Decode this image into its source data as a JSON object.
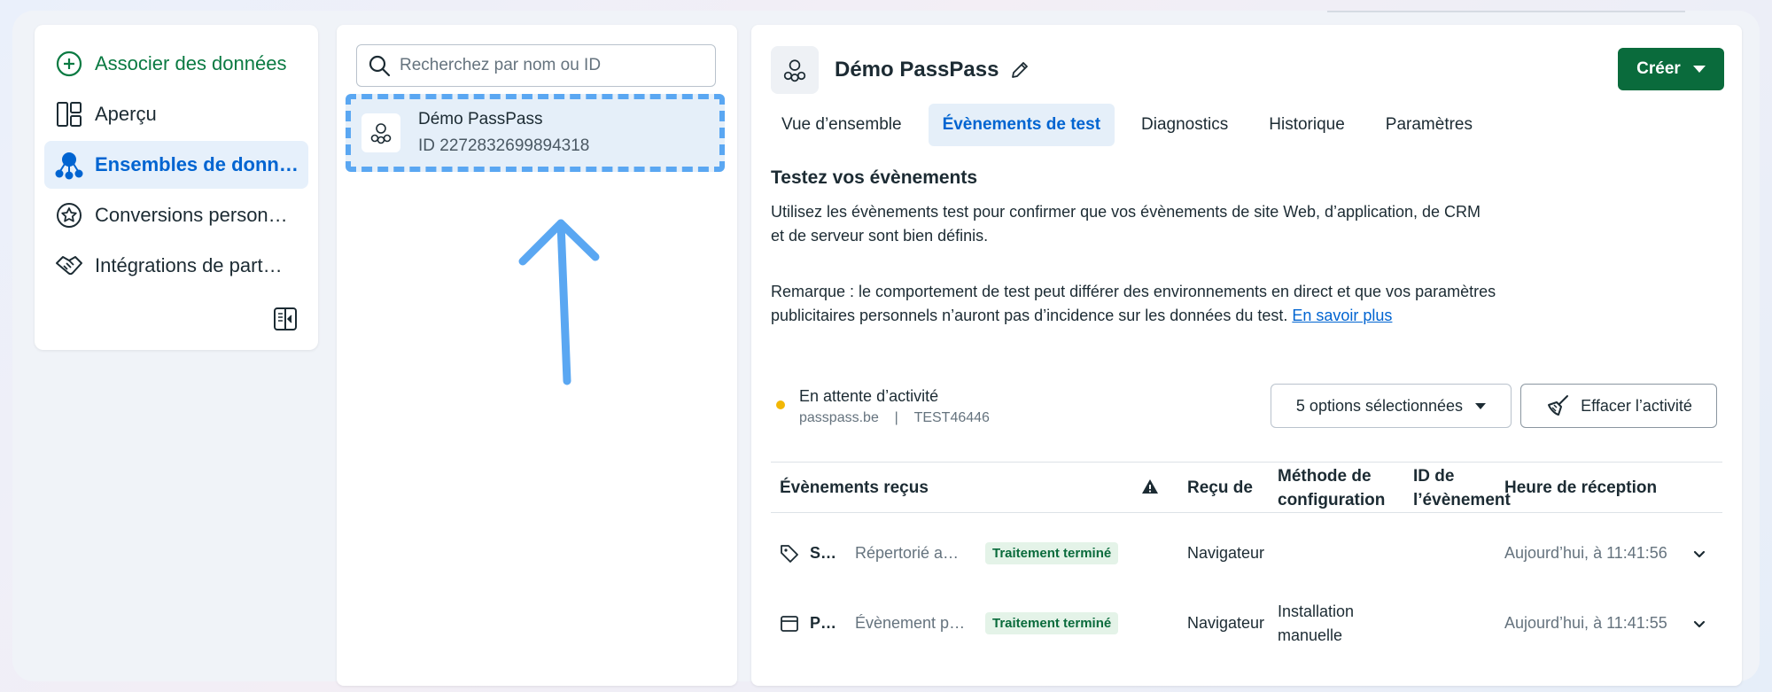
{
  "nav": {
    "items": [
      {
        "label": "Associer des données",
        "icon": "plus-circle-icon"
      },
      {
        "label": "Aperçu",
        "icon": "layout-icon"
      },
      {
        "label": "Ensembles de donn…",
        "icon": "dataset-icon"
      },
      {
        "label": "Conversions person…",
        "icon": "star-icon"
      },
      {
        "label": "Intégrations de part…",
        "icon": "handshake-icon"
      }
    ]
  },
  "middle": {
    "search_placeholder": "Recherchez par nom ou ID",
    "dataset": {
      "name": "Démo PassPass",
      "id": "ID 2272832699894318"
    }
  },
  "main": {
    "title": "Démo PassPass",
    "create_label": "Créer",
    "tabs": [
      "Vue d’ensemble",
      "Évènements de test",
      "Diagnostics",
      "Historique",
      "Paramètres"
    ],
    "section_title": "Testez vos évènements",
    "description": "Utilisez les évènements test pour confirmer que vos évènements de site Web, d’application, de CRM et de serveur sont bien définis.",
    "note": "Remarque : le comportement de test peut différer des environnements en direct et que vos paramètres publicitaires personnels n’auront pas d’incidence sur les données du test.",
    "note_link": "En savoir plus",
    "status": {
      "text": "En attente d’activité",
      "domain": "passpass.be",
      "separator": "|",
      "code": "TEST46446",
      "color": "#f2b705"
    },
    "options_label": "5 options sélectionnées",
    "clear_label": "Effacer l’activité",
    "table": {
      "headers": {
        "events": "Évènements reçus",
        "received_from": "Reçu de",
        "method": "Méthode de configuration",
        "event_id": "ID de l’évènement",
        "time": "Heure de réception"
      },
      "rows": [
        {
          "icon": "tag-icon",
          "name": "S…",
          "detail": "Répertorié a…",
          "status": "Traitement terminé",
          "source": "Navigateur",
          "method": "",
          "event_id": "",
          "time": "Aujourd’hui, à 11:41:56"
        },
        {
          "icon": "browser-icon",
          "name": "P…",
          "detail": "Évènement p…",
          "status": "Traitement terminé",
          "source": "Navigateur",
          "method": "Installation manuelle",
          "event_id": "",
          "time": "Aujourd’hui, à 11:41:55"
        }
      ]
    }
  },
  "colors": {
    "accent_green": "#0a6b3c",
    "accent_blue": "#0064d1",
    "highlight": "#5aa7f2"
  }
}
